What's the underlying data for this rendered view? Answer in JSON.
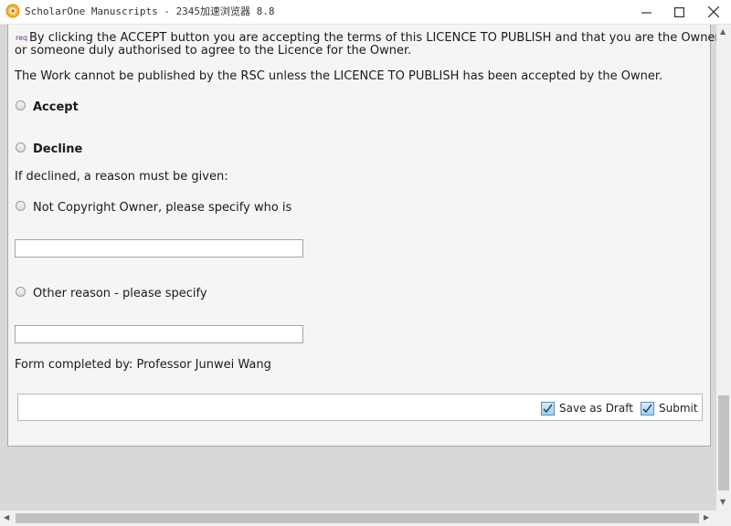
{
  "window": {
    "title": "ScholarOne Manuscripts - 2345加速浏览器 8.8",
    "icon": "browser-logo-icon"
  },
  "form": {
    "req_tag": "req",
    "terms_line1": "By clicking the ACCEPT button you are accepting the terms of this LICENCE TO PUBLISH and that you are the Owner",
    "terms_line2": "or someone duly authorised to agree to the Licence for the Owner.",
    "notice": "The Work cannot be published by the RSC unless the LICENCE TO PUBLISH has been accepted by the Owner.",
    "accept_label": "Accept",
    "decline_label": "Decline",
    "decline_prompt": "If declined, a reason must be given:",
    "not_owner_label": "Not Copyright Owner, please specify who is",
    "not_owner_value": "",
    "other_reason_label": "Other reason - please specify",
    "other_reason_value": "",
    "completed_by": "Form completed by: Professor Junwei Wang"
  },
  "actions": {
    "save_draft_label": "Save as Draft",
    "submit_label": "Submit"
  }
}
